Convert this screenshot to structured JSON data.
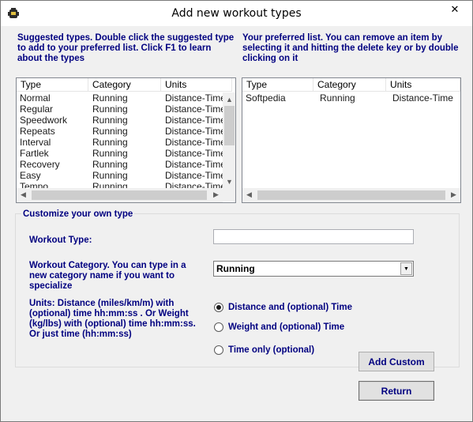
{
  "window": {
    "title": "Add new workout types",
    "close_glyph": "✕"
  },
  "suggested": {
    "instructions": "Suggested types. Double click the suggested type to add to your preferred list. Click F1 to learn about the types",
    "columns": [
      "Type",
      "Category",
      "Units"
    ],
    "rows": [
      [
        "Normal",
        "Running",
        "Distance-Time"
      ],
      [
        "Regular",
        "Running",
        "Distance-Time"
      ],
      [
        "Speedwork",
        "Running",
        "Distance-Time"
      ],
      [
        "Repeats",
        "Running",
        "Distance-Time"
      ],
      [
        "Interval",
        "Running",
        "Distance-Time"
      ],
      [
        "Fartlek",
        "Running",
        "Distance-Time"
      ],
      [
        "Recovery",
        "Running",
        "Distance-Time"
      ],
      [
        "Easy",
        "Running",
        "Distance-Time"
      ],
      [
        "Tempo",
        "Running",
        "Distance-Time"
      ]
    ]
  },
  "preferred": {
    "instructions": "Your preferred list. You can remove an item by selecting it and hitting the delete key or by double clicking on it",
    "columns": [
      "Type",
      "Category",
      "Units"
    ],
    "rows": [
      [
        "Softpedia",
        "Running",
        "Distance-Time"
      ]
    ]
  },
  "custom": {
    "legend": "Customize your own type",
    "workout_type_label": "Workout Type:",
    "workout_type_value": "",
    "category_label": "Workout Category. You can type in a new category name  if you want to specialize",
    "category_value": "Running",
    "units_label": "Units: Distance (miles/km/m) with (optional) time hh:mm:ss . Or Weight (kg/lbs) with (optional)  time hh:mm:ss. Or just time (hh:mm:ss)",
    "unit_options": [
      {
        "label": "Distance and (optional) Time",
        "checked": true
      },
      {
        "label": "Weight and (optional) Time",
        "checked": false
      },
      {
        "label": "Time only (optional)",
        "checked": false
      }
    ],
    "add_button": "Add Custom"
  },
  "return_button": "Return",
  "colors": {
    "label_text": "#000080",
    "window_bg": "#f0f0f0"
  }
}
